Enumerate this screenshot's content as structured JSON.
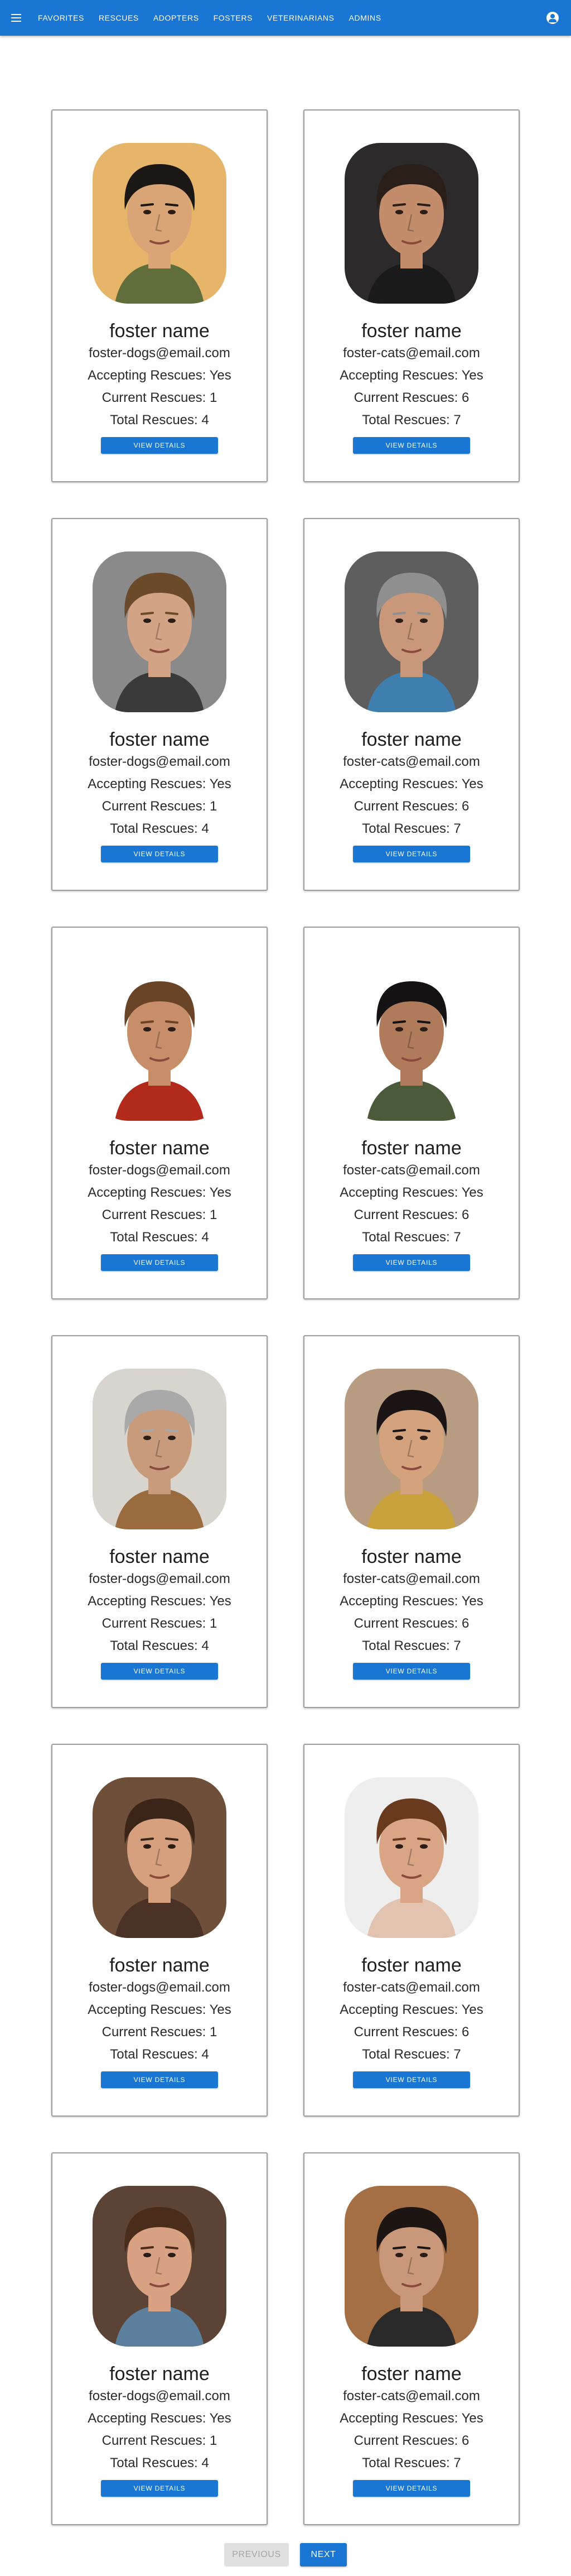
{
  "nav": {
    "items": [
      {
        "label": "FAVORITES"
      },
      {
        "label": "RESCUES"
      },
      {
        "label": "ADOPTERS"
      },
      {
        "label": "FOSTERS"
      },
      {
        "label": "VETERINARIANS"
      },
      {
        "label": "ADMINS"
      }
    ],
    "menu_icon": "menu-icon",
    "account_icon": "account-circle-icon"
  },
  "colors": {
    "primary": "#1976d2",
    "disabled_bg": "#e0e0e0"
  },
  "fosters": [
    {
      "name": "foster name",
      "email": "foster-dogs@email.com",
      "accepting": "Accepting Rescues: Yes",
      "current": "Current Rescues: 1",
      "total": "Total Rescues: 4",
      "button": "VIEW DETAILS",
      "photo": {
        "bg": "#e6b56a",
        "hair": "#1b1714",
        "skin": "#d9a577",
        "shirt": "#5f6e3a"
      }
    },
    {
      "name": "foster name",
      "email": "foster-cats@email.com",
      "accepting": "Accepting Rescues: Yes",
      "current": "Current Rescues: 6",
      "total": "Total Rescues: 7",
      "button": "VIEW DETAILS",
      "photo": {
        "bg": "#2c2a2a",
        "hair": "#2a1f18",
        "skin": "#c38d6b",
        "shirt": "#1a1a1a"
      }
    },
    {
      "name": "foster name",
      "email": "foster-dogs@email.com",
      "accepting": "Accepting Rescues: Yes",
      "current": "Current Rescues: 1",
      "total": "Total Rescues: 4",
      "button": "VIEW DETAILS",
      "photo": {
        "bg": "#8a8a8a",
        "hair": "#6b4a2b",
        "skin": "#d2a485",
        "shirt": "#3a3a3a"
      }
    },
    {
      "name": "foster name",
      "email": "foster-cats@email.com",
      "accepting": "Accepting Rescues: Yes",
      "current": "Current Rescues: 6",
      "total": "Total Rescues: 7",
      "button": "VIEW DETAILS",
      "photo": {
        "bg": "#5e5e5e",
        "hair": "#8f8f8f",
        "skin": "#c9987a",
        "shirt": "#3f7fb0"
      }
    },
    {
      "name": "foster name",
      "email": "foster-dogs@email.com",
      "accepting": "Accepting Rescues: Yes",
      "current": "Current Rescues: 1",
      "total": "Total Rescues: 4",
      "button": "VIEW DETAILS",
      "photo": {
        "bg": "#ffffff",
        "hair": "#6a4426",
        "skin": "#c88e69",
        "shirt": "#b12a1c"
      }
    },
    {
      "name": "foster name",
      "email": "foster-cats@email.com",
      "accepting": "Accepting Rescues: Yes",
      "current": "Current Rescues: 6",
      "total": "Total Rescues: 7",
      "button": "VIEW DETAILS",
      "photo": {
        "bg": "#ffffff",
        "hair": "#141212",
        "skin": "#b07b5b",
        "shirt": "#4a5a3a"
      }
    },
    {
      "name": "foster name",
      "email": "foster-dogs@email.com",
      "accepting": "Accepting Rescues: Yes",
      "current": "Current Rescues: 1",
      "total": "Total Rescues: 4",
      "button": "VIEW DETAILS",
      "photo": {
        "bg": "#d8d5cf",
        "hair": "#a9a9a9",
        "skin": "#c99b7d",
        "shirt": "#9a6b3f"
      }
    },
    {
      "name": "foster name",
      "email": "foster-cats@email.com",
      "accepting": "Accepting Rescues: Yes",
      "current": "Current Rescues: 6",
      "total": "Total Rescues: 7",
      "button": "VIEW DETAILS",
      "photo": {
        "bg": "#b89c82",
        "hair": "#1a1514",
        "skin": "#d4a27c",
        "shirt": "#c9a13d"
      }
    },
    {
      "name": "foster name",
      "email": "foster-dogs@email.com",
      "accepting": "Accepting Rescues: Yes",
      "current": "Current Rescues: 1",
      "total": "Total Rescues: 4",
      "button": "VIEW DETAILS",
      "photo": {
        "bg": "#6e4f3a",
        "hair": "#3b2418",
        "skin": "#d6a07e",
        "shirt": "#4a3226"
      }
    },
    {
      "name": "foster name",
      "email": "foster-cats@email.com",
      "accepting": "Accepting Rescues: Yes",
      "current": "Current Rescues: 6",
      "total": "Total Rescues: 7",
      "button": "VIEW DETAILS",
      "photo": {
        "bg": "#eeeeee",
        "hair": "#6a3a1e",
        "skin": "#d9a585",
        "shirt": "#e2c3b0"
      }
    },
    {
      "name": "foster name",
      "email": "foster-dogs@email.com",
      "accepting": "Accepting Rescues: Yes",
      "current": "Current Rescues: 1",
      "total": "Total Rescues: 4",
      "button": "VIEW DETAILS",
      "photo": {
        "bg": "#5b4435",
        "hair": "#4a2c1a",
        "skin": "#d7a182",
        "shirt": "#5c7f9e"
      }
    },
    {
      "name": "foster name",
      "email": "foster-cats@email.com",
      "accepting": "Accepting Rescues: Yes",
      "current": "Current Rescues: 6",
      "total": "Total Rescues: 7",
      "button": "VIEW DETAILS",
      "photo": {
        "bg": "#a56f45",
        "hair": "#1d1512",
        "skin": "#c9987a",
        "shirt": "#2a2a2a"
      }
    }
  ],
  "pager": {
    "previous": "PREVIOUS",
    "next": "NEXT"
  }
}
